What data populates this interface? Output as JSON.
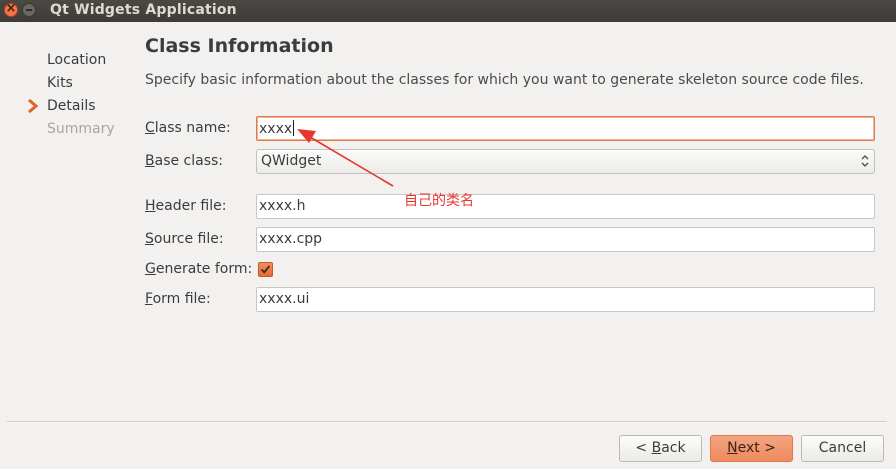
{
  "window": {
    "title": "Qt Widgets Application"
  },
  "steps": [
    {
      "label": "Location",
      "state": "done"
    },
    {
      "label": "Kits",
      "state": "done"
    },
    {
      "label": "Details",
      "state": "current"
    },
    {
      "label": "Summary",
      "state": "pending"
    }
  ],
  "page": {
    "heading": "Class Information",
    "description": "Specify basic information about the classes for which you want to generate skeleton source code files."
  },
  "form": {
    "class_name": {
      "mnemonic": "C",
      "rest": "lass name:",
      "value": "xxxx"
    },
    "base_class": {
      "mnemonic": "B",
      "rest": "ase class:",
      "value": "QWidget"
    },
    "header_file": {
      "mnemonic": "H",
      "rest": "eader file:",
      "value": "xxxx.h"
    },
    "source_file": {
      "mnemonic": "S",
      "rest": "ource file:",
      "value": "xxxx.cpp"
    },
    "generate_form": {
      "mnemonic": "G",
      "rest": "enerate form:",
      "checked": true
    },
    "form_file": {
      "mnemonic": "F",
      "rest": "orm file:",
      "value": "xxxx.ui"
    }
  },
  "annotation": {
    "text": "自己的类名",
    "color": "#e8362f"
  },
  "buttons": {
    "back": {
      "prefix": "< ",
      "mnemonic": "B",
      "rest": "ack"
    },
    "next": {
      "mnemonic": "N",
      "rest": "ext >"
    },
    "cancel": {
      "label": "Cancel"
    }
  },
  "colors": {
    "accent": "#ee8a5e",
    "titlebar": "#3d3c38",
    "background": "#f2f1f0"
  }
}
